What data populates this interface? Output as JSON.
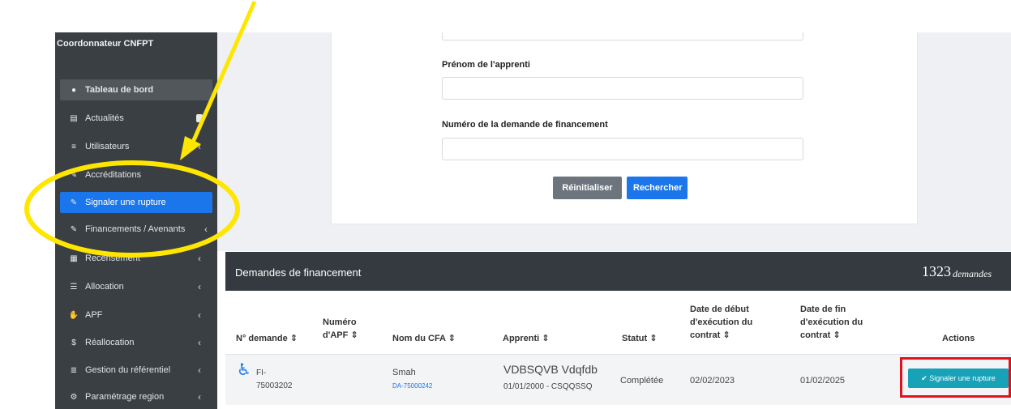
{
  "sidebar": {
    "role": "Coordonnateur CNFPT",
    "items": [
      {
        "label": "Tableau de bord",
        "icon": "dashboard-icon"
      },
      {
        "label": "Actualités",
        "icon": "news-icon"
      },
      {
        "label": "Utilisateurs",
        "icon": "list-icon"
      },
      {
        "label": "Accréditations",
        "icon": "edit-icon"
      },
      {
        "label": "Signaler une rupture",
        "icon": "edit-icon"
      },
      {
        "label": "Financements / Avenants",
        "icon": "edit-icon"
      },
      {
        "label": "Recensement",
        "icon": "building-icon"
      },
      {
        "label": "Allocation",
        "icon": "list-icon"
      },
      {
        "label": "APF",
        "icon": "handshake-icon"
      },
      {
        "label": "Réallocation",
        "icon": "dollar-icon"
      },
      {
        "label": "Gestion du référentiel",
        "icon": "database-icon"
      },
      {
        "label": "Paramétrage region",
        "icon": "gear-icon"
      }
    ]
  },
  "form": {
    "prenom_label": "Prénom de l'apprenti",
    "numero_label": "Numéro de la demande de financement",
    "reset_label": "Réinitialiser",
    "search_label": "Rechercher"
  },
  "table": {
    "title": "Demandes de financement",
    "count": "1323",
    "count_suffix": "demandes",
    "columns": [
      "N° demande ⇕",
      "Numéro d'APF ⇕",
      "Nom du CFA ⇕",
      "Apprenti ⇕",
      "Statut ⇕",
      "Date de début d'exécution du contrat ⇕",
      "Date de fin d'exécution du contrat ⇕",
      "Actions"
    ],
    "row": {
      "numero": "FI-75003202",
      "cfa_name": "Smah",
      "cfa_link": "DA-75000242",
      "apprenti_name": "VDBSQVB Vdqfdb",
      "apprenti_info": "01/01/2000 - CSQQSSQ",
      "statut": "Complétée",
      "date_debut": "02/02/2023",
      "date_fin": "01/02/2025",
      "action_label": "✔ Signaler une rupture"
    }
  },
  "colors": {
    "sidebar_bg": "#3a3f44",
    "active": "#1a76ea",
    "annotation_yellow": "#ffe600",
    "highlight_red": "#e0131c",
    "action_teal": "#17a2b8"
  }
}
